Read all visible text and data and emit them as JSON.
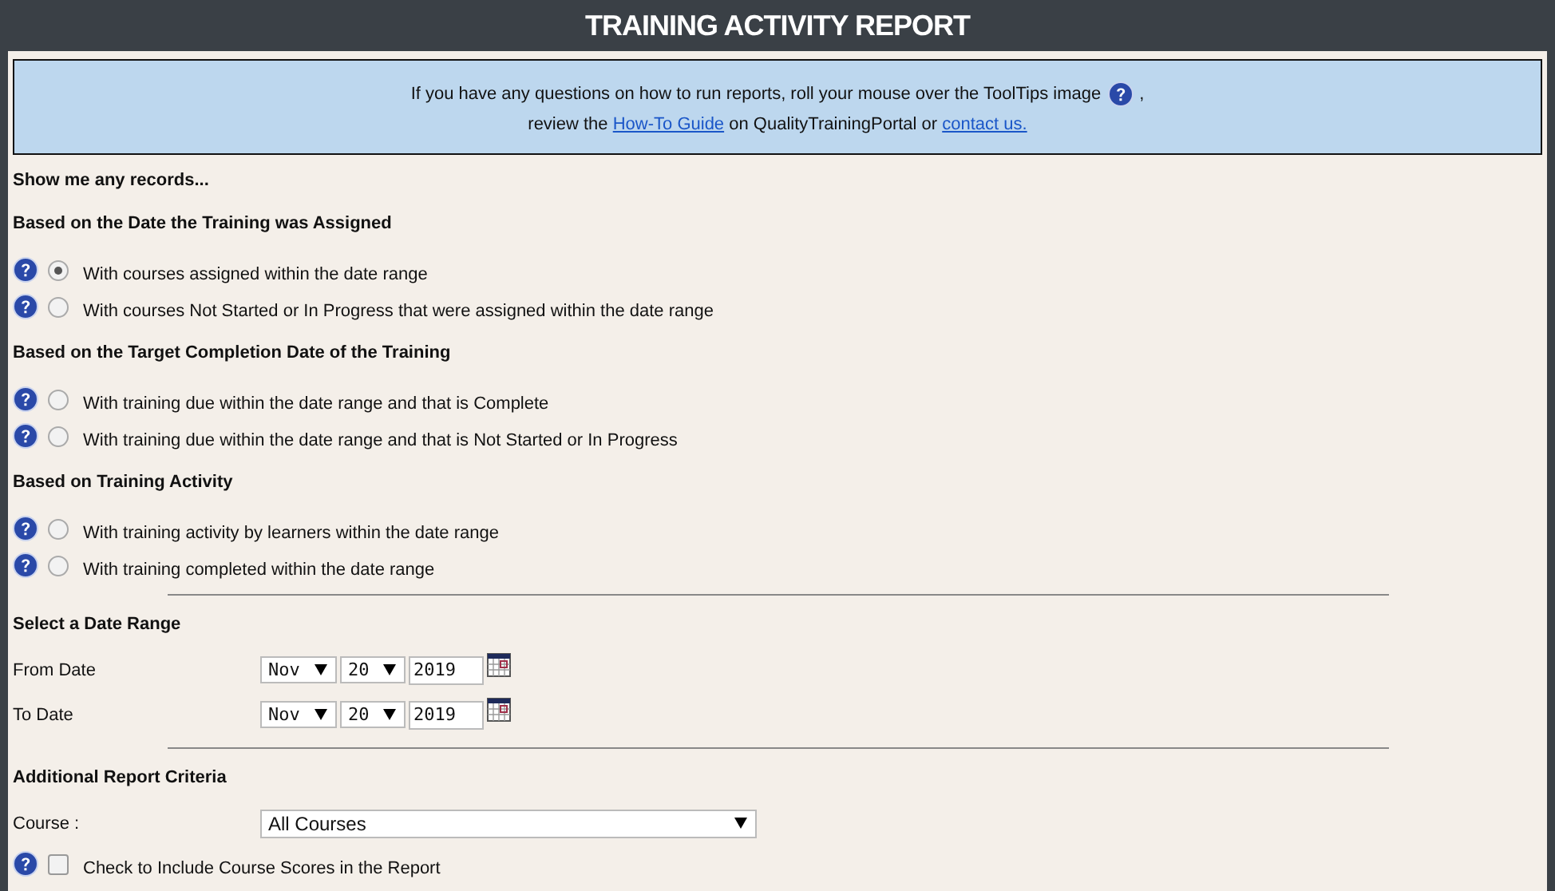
{
  "header": {
    "title": "TRAINING ACTIVITY REPORT"
  },
  "info": {
    "line1": "If you have any questions on how to run reports, roll your mouse over the ToolTips image",
    "line1_end": ",",
    "line2_before": "review the",
    "link1": "How-To Guide",
    "line2_middle": "on QualityTrainingPortal or",
    "link2": "contact us."
  },
  "intro": "Show me any records...",
  "groups": [
    {
      "heading": "Based on the Date the Training was Assigned",
      "options": [
        {
          "label": "With courses assigned within the date range",
          "selected": true
        },
        {
          "label": "With courses Not Started or In Progress that were assigned within the date range",
          "selected": false
        }
      ]
    },
    {
      "heading": "Based on the Target Completion Date of the Training",
      "options": [
        {
          "label": "With training due within the date range and that is Complete",
          "selected": false
        },
        {
          "label": "With training due within the date range and that is Not Started or In Progress",
          "selected": false
        }
      ]
    },
    {
      "heading": "Based on Training Activity",
      "options": [
        {
          "label": "With training activity by learners within the date range",
          "selected": false
        },
        {
          "label": "With training completed within the date range",
          "selected": false
        }
      ]
    }
  ],
  "date_range": {
    "heading": "Select a Date Range",
    "rows": [
      {
        "label": "From Date",
        "month": "Nov",
        "day": "20",
        "year": "2019"
      },
      {
        "label": "To Date",
        "month": "Nov",
        "day": "20",
        "year": "2019"
      }
    ]
  },
  "criteria": {
    "heading": "Additional Report Criteria",
    "course_label": "Course :",
    "course_value": "All Courses",
    "scores_label": "Check to Include Course Scores in the Report",
    "scores_checked": false
  }
}
